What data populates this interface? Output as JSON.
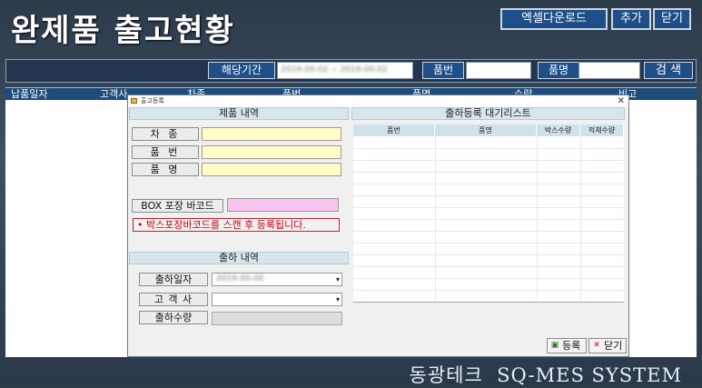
{
  "header": {
    "title": "완제품 출고현황",
    "buttons": {
      "excel": "엑셀다운로드",
      "add": "추가",
      "close": "닫기"
    }
  },
  "filter": {
    "period_label": "해당기간",
    "period_value": "2019-00-02 ~ 2019-00-02",
    "part_no_label": "품번",
    "part_no_value": "",
    "part_name_label": "품명",
    "part_name_value": "",
    "search_button": "검 색"
  },
  "grid": {
    "columns": [
      "납품일자",
      "고객사",
      "차종",
      "품번",
      "품명",
      "수량",
      "비고"
    ]
  },
  "dialog": {
    "title": "출고등록",
    "product_section": "제품 내역",
    "fields": {
      "car_type": "차 종",
      "part_no": "품 번",
      "part_name": "품 명"
    },
    "barcode_label": "BOX 포장 바코드",
    "barcode_value": "",
    "warning": "• 박스포장바코드를 스캔 후 등록됩니다.",
    "shipment_section": "출하 내역",
    "ship_date_label": "출하일자",
    "ship_date_value": "2019-00-00",
    "customer_label": "고 객 사",
    "customer_value": "",
    "ship_qty_label": "출하수량",
    "waitlist_title": "출하등록 대기리스트",
    "waitlist_columns": [
      "품번",
      "품명",
      "박스수량",
      "적재수량"
    ],
    "register_button": "등록",
    "close_button": "닫기"
  },
  "footer": {
    "company": "동광테크",
    "system": "SQ-MES SYSTEM"
  },
  "colors": {
    "accent": "#1e4f86",
    "input_yellow": "#ffffc6",
    "input_pink": "#f9c4ef",
    "warning": "#c0001a"
  }
}
